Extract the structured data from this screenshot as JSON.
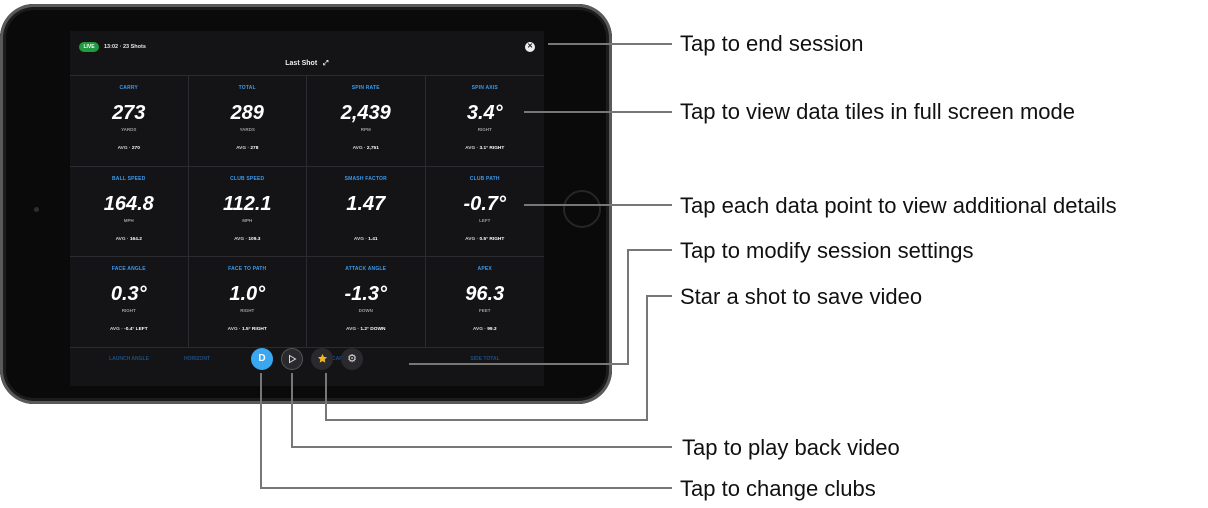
{
  "session": {
    "live_badge": "LIVE",
    "info": "13:02 · 23 Shots",
    "view_title": "Last Shot"
  },
  "tiles": [
    {
      "label": "CARRY",
      "value": "273",
      "unit": "YARDS",
      "avg_label": "AVG · ",
      "avg_value": "270"
    },
    {
      "label": "TOTAL",
      "value": "289",
      "unit": "YARDS",
      "avg_label": "AVG · ",
      "avg_value": "278"
    },
    {
      "label": "SPIN RATE",
      "value": "2,439",
      "unit": "RPM",
      "avg_label": "AVG · ",
      "avg_value": "2,751"
    },
    {
      "label": "SPIN AXIS",
      "value": "3.4°",
      "unit": "RIGHT",
      "avg_label": "AVG · ",
      "avg_value": "3.1° RIGHT"
    },
    {
      "label": "BALL SPEED",
      "value": "164.8",
      "unit": "MPH",
      "avg_label": "AVG · ",
      "avg_value": "164.2"
    },
    {
      "label": "CLUB SPEED",
      "value": "112.1",
      "unit": "MPH",
      "avg_label": "AVG · ",
      "avg_value": "109.3"
    },
    {
      "label": "SMASH FACTOR",
      "value": "1.47",
      "unit": "",
      "avg_label": "AVG · ",
      "avg_value": "1.41"
    },
    {
      "label": "CLUB PATH",
      "value": "-0.7°",
      "unit": "LEFT",
      "avg_label": "AVG · ",
      "avg_value": "0.5° RIGHT"
    },
    {
      "label": "FACE ANGLE",
      "value": "0.3°",
      "unit": "RIGHT",
      "avg_label": "AVG · ",
      "avg_value": "-0.4° LEFT"
    },
    {
      "label": "FACE TO PATH",
      "value": "1.0°",
      "unit": "RIGHT",
      "avg_label": "AVG · ",
      "avg_value": "1.5° RIGHT"
    },
    {
      "label": "ATTACK ANGLE",
      "value": "-1.3°",
      "unit": "DOWN",
      "avg_label": "AVG · ",
      "avg_value": "1.2° DOWN"
    },
    {
      "label": "APEX",
      "value": "96.3",
      "unit": "FEET",
      "avg_label": "AVG · ",
      "avg_value": "99.3"
    }
  ],
  "row4_labels": [
    "LAUNCH ANGLE",
    "HORIZONT",
    "CARRY",
    "SIDE TOTAL"
  ],
  "controls": {
    "club_button": "D",
    "play_icon": "play-icon",
    "star_icon": "star-icon",
    "settings_icon": "gear-icon",
    "club_color": "#3aa8f0",
    "star_color": "#f2b628"
  },
  "annotations": {
    "end_session": "Tap to end session",
    "full_screen": "Tap to view data tiles in full screen mode",
    "details": "Tap each data point to view additional details",
    "settings": "Tap to modify session settings",
    "star": "Star a shot to save video",
    "playback": "Tap to play back video",
    "clubs": "Tap to change clubs"
  }
}
